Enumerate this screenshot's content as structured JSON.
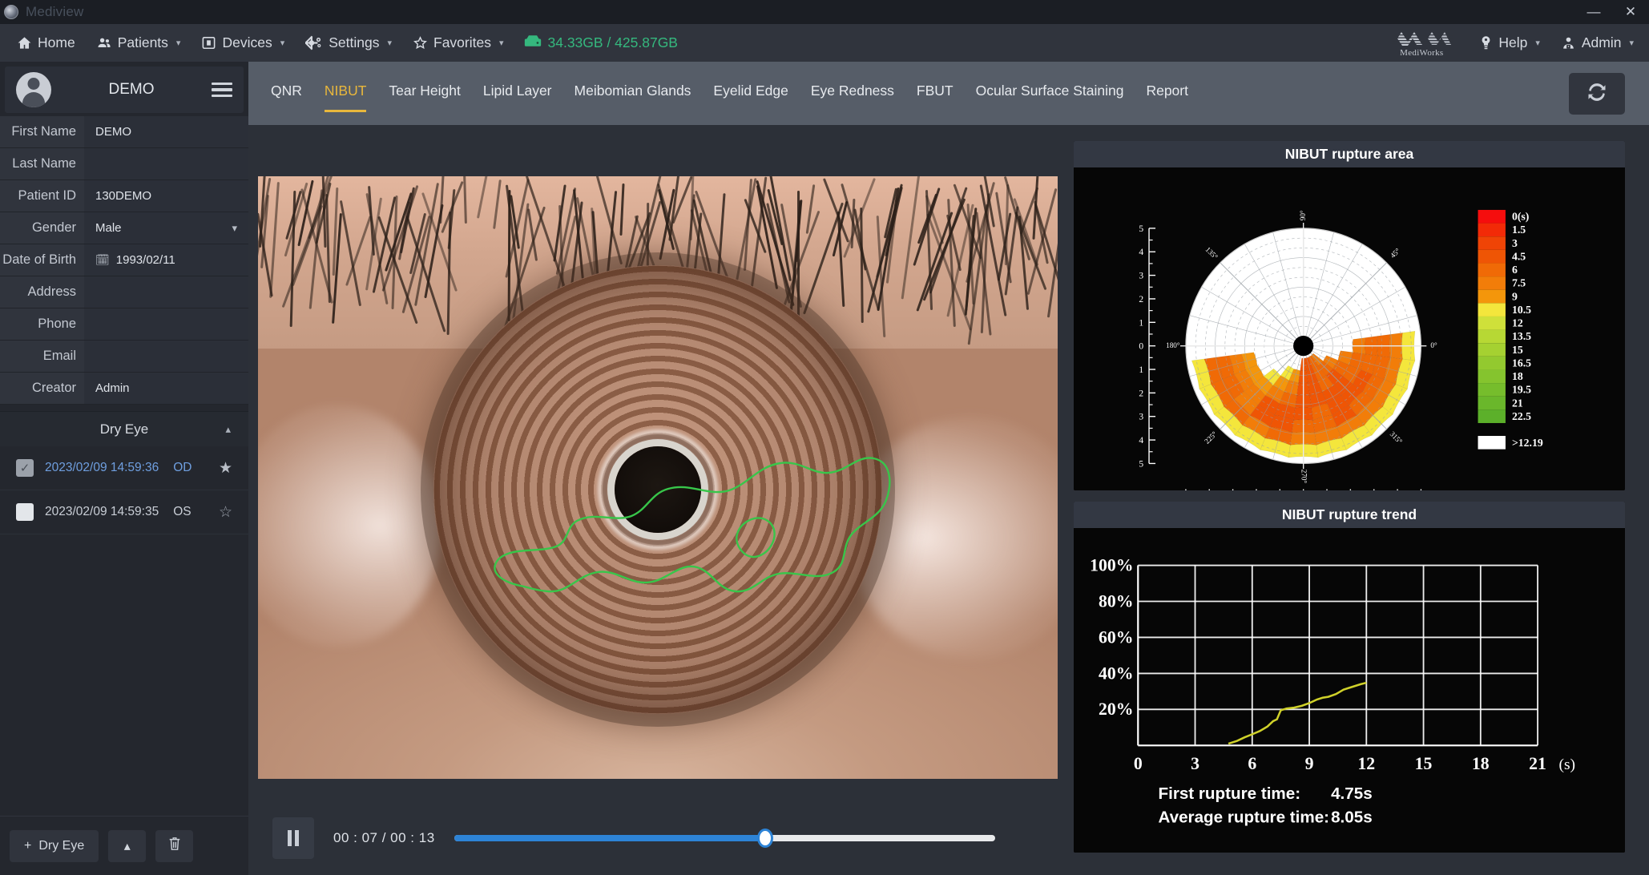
{
  "window": {
    "title": "Mediview",
    "minimize": "—",
    "close": "✕"
  },
  "menubar": {
    "items": [
      {
        "label": "Home",
        "icon": "home-icon",
        "caret": false
      },
      {
        "label": "Patients",
        "icon": "patients-icon",
        "caret": true
      },
      {
        "label": "Devices",
        "icon": "devices-icon",
        "caret": true
      },
      {
        "label": "Settings",
        "icon": "settings-gear-icon",
        "caret": true
      },
      {
        "label": "Favorites",
        "icon": "star-icon",
        "caret": true
      }
    ],
    "storage": {
      "icon": "hard-drive-icon",
      "text": "34.33GB / 425.87GB",
      "color": "#35b87e"
    },
    "brand": {
      "name": "MediWorks",
      "icon": "mediworks-logo-icon"
    },
    "help": {
      "label": "Help",
      "icon": "help-bulb-icon",
      "caret": true
    },
    "user": {
      "label": "Admin",
      "icon": "user-admin-icon",
      "caret": true
    }
  },
  "sidebar": {
    "patient_name": "DEMO",
    "fields": [
      {
        "label": "First Name",
        "value": "DEMO",
        "type": "text"
      },
      {
        "label": "Last Name",
        "value": "",
        "type": "text"
      },
      {
        "label": "Patient ID",
        "value": "130DEMO",
        "type": "text"
      },
      {
        "label": "Gender",
        "value": "Male",
        "type": "select"
      },
      {
        "label": "Date of Birth",
        "value": "1993/02/11",
        "type": "date"
      },
      {
        "label": "Address",
        "value": "",
        "type": "text"
      },
      {
        "label": "Phone",
        "value": "",
        "type": "text"
      },
      {
        "label": "Email",
        "value": "",
        "type": "text"
      },
      {
        "label": "Creator",
        "value": "Admin",
        "type": "text"
      }
    ],
    "group": {
      "label": "Dry Eye",
      "collapse_icon": "chevron-up-icon"
    },
    "exams": [
      {
        "date": "2023/02/09 14:59:36",
        "eye": "OD",
        "checked": true,
        "starred": true
      },
      {
        "date": "2023/02/09 14:59:35",
        "eye": "OS",
        "checked": false,
        "starred": false
      }
    ],
    "footer": {
      "add_label": "Dry Eye",
      "add_icon": "plus-icon",
      "up_icon": "caret-up-icon",
      "delete_icon": "trash-icon"
    }
  },
  "tabs": [
    {
      "label": "QNR",
      "active": false
    },
    {
      "label": "NIBUT",
      "active": true
    },
    {
      "label": "Tear Height",
      "active": false
    },
    {
      "label": "Lipid Layer",
      "active": false
    },
    {
      "label": "Meibomian Glands",
      "active": false
    },
    {
      "label": "Eyelid Edge",
      "active": false
    },
    {
      "label": "Eye Redness",
      "active": false
    },
    {
      "label": "FBUT",
      "active": false
    },
    {
      "label": "Ocular Surface Staining",
      "active": false
    },
    {
      "label": "Report",
      "active": false
    }
  ],
  "toolbar": {
    "refresh_icon": "refresh-icon"
  },
  "player": {
    "state_icon": "pause-icon",
    "time": "00 : 07 / 00 : 13",
    "current_seconds": 7,
    "total_seconds": 13,
    "progress_percent": 57.5
  },
  "viewer": {
    "image": "eye-cornea-placido-rings",
    "overlay": "rupture-outline-green",
    "overlay_color": "#38c64a"
  },
  "chart_data": [
    {
      "type": "heatmap",
      "id": "nibut-rupture-area",
      "title": "NIBUT rupture area",
      "subtype": "polar-sector",
      "angle_labels": [
        "0°",
        "45°",
        "90°",
        "135°",
        "180°",
        "225°",
        "270°",
        "315°"
      ],
      "radial_axis_ticks": [
        "5",
        "4",
        "3",
        "2",
        "1",
        "0",
        "1",
        "2",
        "3",
        "4",
        "5"
      ],
      "horizontal_axis_ticks": [
        "5",
        "4",
        "3",
        "2",
        "1",
        "0",
        "1",
        "2",
        "3",
        "4",
        "5"
      ],
      "legend": {
        "title": "0(s)",
        "labels": [
          "0(s)",
          "1.5",
          "3",
          "4.5",
          "6",
          "7.5",
          "9",
          "10.5",
          "12",
          "13.5",
          "15",
          "16.5",
          "18",
          "19.5",
          "21",
          "22.5"
        ],
        "colors": [
          "#f50d0d",
          "#f22a07",
          "#ef4406",
          "#ef5505",
          "#f06a06",
          "#f27d09",
          "#f4960b",
          "#f4e63c",
          "#cfe03a",
          "#b7d834",
          "#a5d131",
          "#93c92f",
          "#85c42e",
          "#76bd2c",
          "#6ab72b",
          "#5cb02a"
        ],
        "overflow_label": ">12.19",
        "overflow_color": "#ffffff"
      },
      "sectors": [
        {
          "angle_deg": 195,
          "ring_values": [
            null,
            null,
            null,
            9.0,
            7.5,
            6.0,
            6.0,
            10.5
          ]
        },
        {
          "angle_deg": 210,
          "ring_values": [
            null,
            null,
            null,
            9.0,
            7.5,
            6.0,
            6.0,
            10.5
          ]
        },
        {
          "angle_deg": 225,
          "ring_values": [
            null,
            null,
            10.5,
            9.0,
            7.5,
            7.5,
            6.0,
            10.5
          ]
        },
        {
          "angle_deg": 240,
          "ring_values": [
            null,
            10.5,
            9.0,
            7.5,
            4.5,
            4.5,
            7.5,
            10.5
          ]
        },
        {
          "angle_deg": 255,
          "ring_values": [
            null,
            9.0,
            7.5,
            6.0,
            4.5,
            4.5,
            6.0,
            10.5
          ]
        },
        {
          "angle_deg": 270,
          "ring_values": [
            4.5,
            4.5,
            4.5,
            4.5,
            4.5,
            6.0,
            7.5,
            10.5
          ]
        },
        {
          "angle_deg": 285,
          "ring_values": [
            4.5,
            4.5,
            4.5,
            4.5,
            6.0,
            6.0,
            7.5,
            10.5
          ]
        },
        {
          "angle_deg": 300,
          "ring_values": [
            6.0,
            6.0,
            6.0,
            4.5,
            4.5,
            4.5,
            7.5,
            10.5
          ]
        },
        {
          "angle_deg": 315,
          "ring_values": [
            7.5,
            6.0,
            4.5,
            4.5,
            4.5,
            6.0,
            7.5,
            10.5
          ]
        },
        {
          "angle_deg": 330,
          "ring_values": [
            null,
            7.5,
            6.0,
            6.0,
            4.5,
            6.0,
            7.5,
            10.5
          ]
        },
        {
          "angle_deg": 345,
          "ring_values": [
            null,
            null,
            7.5,
            6.0,
            6.0,
            6.0,
            7.5,
            10.5
          ]
        },
        {
          "angle_deg": 0,
          "ring_values": [
            null,
            null,
            null,
            7.5,
            6.0,
            6.0,
            7.5,
            10.5
          ]
        }
      ]
    },
    {
      "type": "line",
      "id": "nibut-rupture-trend",
      "title": "NIBUT rupture trend",
      "xlabel": "(s)",
      "ylabel": "",
      "xticks": [
        0,
        3,
        6,
        9,
        12,
        15,
        18,
        21
      ],
      "yticks": [
        "20%",
        "40%",
        "60%",
        "80%",
        "100%"
      ],
      "xlim": [
        0,
        21
      ],
      "ylim": [
        0,
        100
      ],
      "grid": true,
      "line_color": "#cfd12a",
      "x": [
        4.75,
        5.2,
        5.6,
        6.0,
        6.4,
        6.8,
        7.1,
        7.3,
        7.5,
        7.8,
        8.2,
        8.6,
        9.0,
        9.4,
        9.7,
        10.0,
        10.4,
        10.8,
        11.1,
        11.4,
        11.7,
        12.0
      ],
      "y": [
        1.0,
        2.5,
        4.5,
        6.2,
        8.0,
        10.5,
        13.5,
        14.5,
        19.5,
        20.5,
        21.0,
        22.0,
        23.5,
        25.5,
        26.5,
        27.0,
        28.5,
        31.0,
        32.0,
        33.0,
        34.0,
        34.8
      ],
      "annotations": [
        {
          "label": "First rupture time:",
          "value": "4.75s"
        },
        {
          "label": "Average rupture time:",
          "value": "8.05s"
        }
      ]
    }
  ]
}
